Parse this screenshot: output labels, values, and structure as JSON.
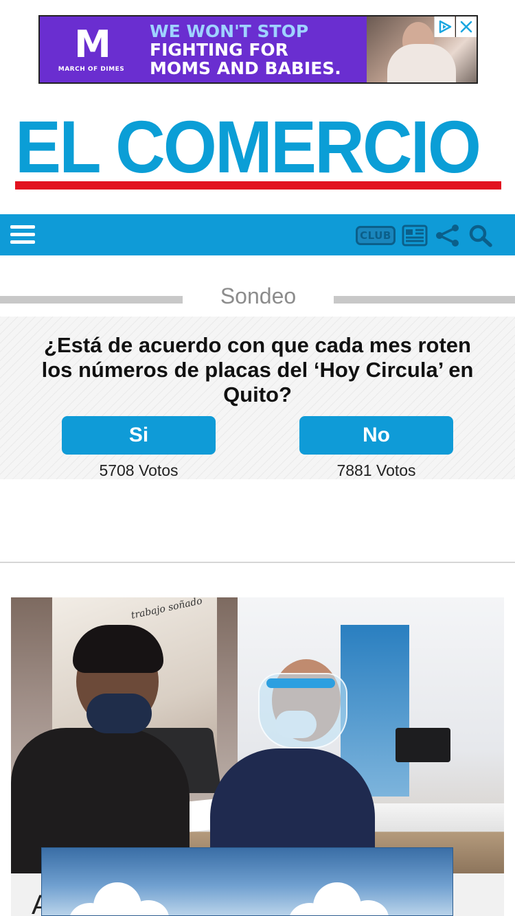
{
  "ad": {
    "logo_mark": "M",
    "logo_text": "MARCH OF DIMES",
    "headline": [
      "WE WON'T STOP",
      "FIGHTING FOR",
      "MOMS AND BABIES."
    ],
    "choices_icon": "adchoices-icon",
    "close_icon": "close-icon",
    "colors": {
      "background": "#6a2ed0",
      "highlight": "#9fd2ff"
    }
  },
  "masthead": {
    "title": "EL COMERCIO",
    "colors": {
      "title": "#0b9ed6",
      "rule": "#e2121f"
    }
  },
  "navbar": {
    "menu_icon": "hamburger-menu-icon",
    "club_label": "CLUB",
    "icons": [
      "club-icon",
      "newspaper-icon",
      "share-icon",
      "search-icon"
    ],
    "color": "#0f9bd7"
  },
  "poll": {
    "section_label": "Sondeo",
    "question": "¿Está de acuerdo con que cada mes roten los números de placas del ‘Hoy Circula’ en Quito?",
    "options": [
      {
        "label": "Si",
        "votes": "5708 Votos"
      },
      {
        "label": "No",
        "votes": "7881 Votos"
      }
    ]
  },
  "article": {
    "photo_poster_text": "trabajo soñado",
    "photo_icon": "article-photo",
    "teaser_char": "A"
  }
}
